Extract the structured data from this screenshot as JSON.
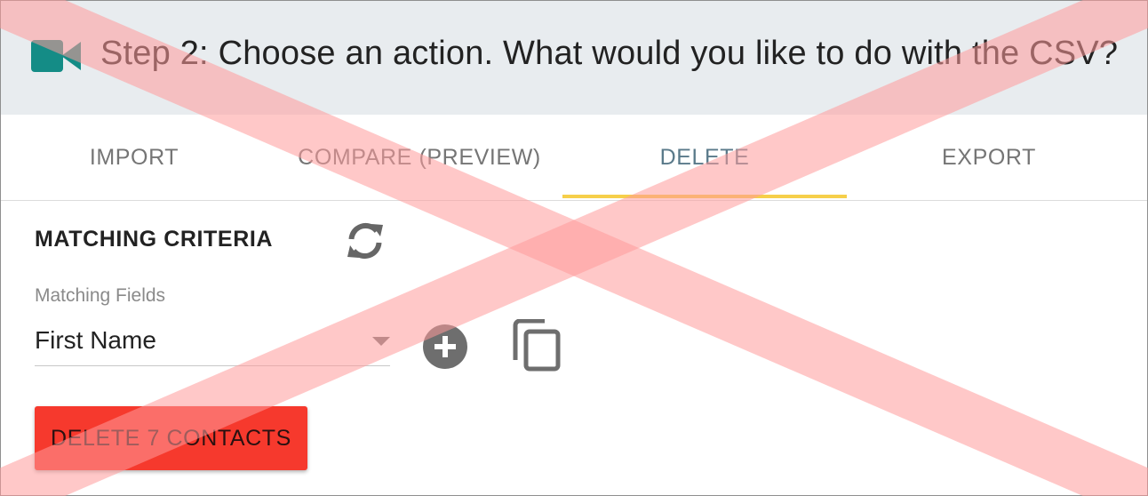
{
  "header": {
    "title": "Step 2: Choose an action. What would you like to do with the CSV?",
    "icon": "video-camera-icon",
    "icon_color": "#148c86"
  },
  "tabs": [
    {
      "label": "IMPORT",
      "active": false
    },
    {
      "label": "COMPARE (PREVIEW)",
      "active": false
    },
    {
      "label": "DELETE",
      "active": true
    },
    {
      "label": "EXPORT",
      "active": false
    }
  ],
  "tab_indicator_color": "#f6cf4a",
  "matching": {
    "section_title": "MATCHING CRITERIA",
    "refresh_icon": "refresh-icon",
    "field_label": "Matching Fields",
    "selected_field": "First Name",
    "add_icon": "add-circle-icon",
    "copy_icon": "copy-icon"
  },
  "delete_button": {
    "label": "DELETE 7 CONTACTS",
    "color": "#f6392d"
  },
  "overlay": {
    "type": "red-cross-mark",
    "color": "#ff9a9a"
  }
}
